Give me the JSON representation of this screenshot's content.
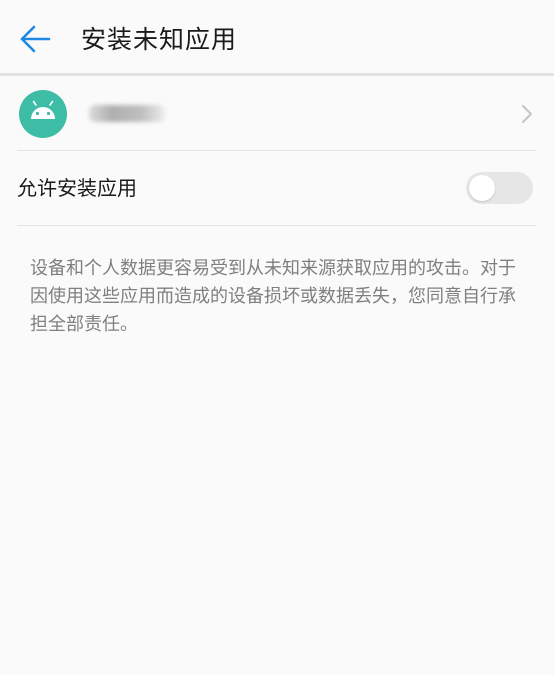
{
  "header": {
    "title": "安装未知应用",
    "back_icon": "arrow-left-icon",
    "accent_color": "#1e88e5"
  },
  "app": {
    "icon": "android-icon",
    "icon_color": "#3dbca6",
    "name_redacted": true,
    "chevron_icon": "chevron-right-icon"
  },
  "setting": {
    "label": "允许安装应用",
    "enabled": false
  },
  "warning_text": "设备和个人数据更容易受到从未知来源获取应用的攻击。对于因使用这些应用而造成的设备损坏或数据丢失，您同意自行承担全部责任。"
}
